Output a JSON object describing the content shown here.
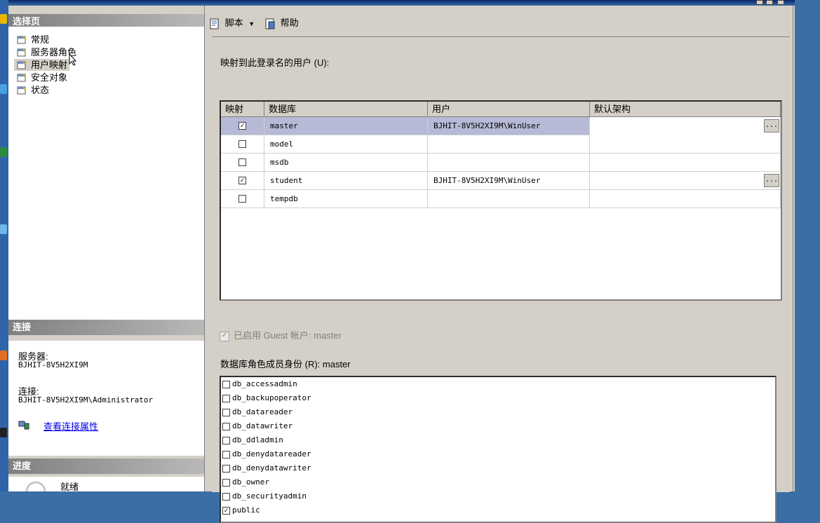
{
  "left_panel": {
    "select_page_header": "选择页",
    "pages": [
      {
        "label": "常规",
        "selected": false
      },
      {
        "label": "服务器角色",
        "selected": false
      },
      {
        "label": "用户映射",
        "selected": true
      },
      {
        "label": "安全对象",
        "selected": false
      },
      {
        "label": "状态",
        "selected": false
      }
    ],
    "connection_header": "连接",
    "server_label": "服务器:",
    "server_value": "BJHIT-8V5H2XI9M",
    "connection_label": "连接:",
    "connection_value": "BJHIT-8V5H2XI9M\\Administrator",
    "view_props_link": "查看连接属性",
    "progress_header": "进度",
    "progress_status": "就绪"
  },
  "toolbar": {
    "script_label": "脚本",
    "help_label": "帮助"
  },
  "mapping": {
    "caption": "映射到此登录名的用户 (U):",
    "columns": [
      "映射",
      "数据库",
      "用户",
      "默认架构"
    ],
    "rows": [
      {
        "mapped": true,
        "database": "master",
        "user": "BJHIT-8V5H2XI9M\\WinUser",
        "schema": "",
        "selected": true
      },
      {
        "mapped": false,
        "database": "model",
        "user": "",
        "schema": "",
        "selected": false
      },
      {
        "mapped": false,
        "database": "msdb",
        "user": "",
        "schema": "",
        "selected": false
      },
      {
        "mapped": true,
        "database": "student",
        "user": "BJHIT-8V5H2XI9M\\WinUser",
        "schema": "",
        "selected": false
      },
      {
        "mapped": false,
        "database": "tempdb",
        "user": "",
        "schema": "",
        "selected": false
      }
    ],
    "ellipsis": "..."
  },
  "guest": {
    "label": "已启用 Guest 帐户: master",
    "checked": true
  },
  "roles": {
    "caption": "数据库角色成员身份 (R): master",
    "items": [
      {
        "name": "db_accessadmin",
        "checked": false
      },
      {
        "name": "db_backupoperator",
        "checked": false
      },
      {
        "name": "db_datareader",
        "checked": false
      },
      {
        "name": "db_datawriter",
        "checked": false
      },
      {
        "name": "db_ddladmin",
        "checked": false
      },
      {
        "name": "db_denydatareader",
        "checked": false
      },
      {
        "name": "db_denydatawriter",
        "checked": false
      },
      {
        "name": "db_owner",
        "checked": false
      },
      {
        "name": "db_securityadmin",
        "checked": false
      },
      {
        "name": "public",
        "checked": true
      }
    ]
  },
  "colors": {
    "selection": "#b6bad6",
    "panel": "#d4d0c8",
    "header_gradient_start": "#7f7f7f",
    "link": "#0000ee",
    "desktop": "#3b6ea5"
  }
}
